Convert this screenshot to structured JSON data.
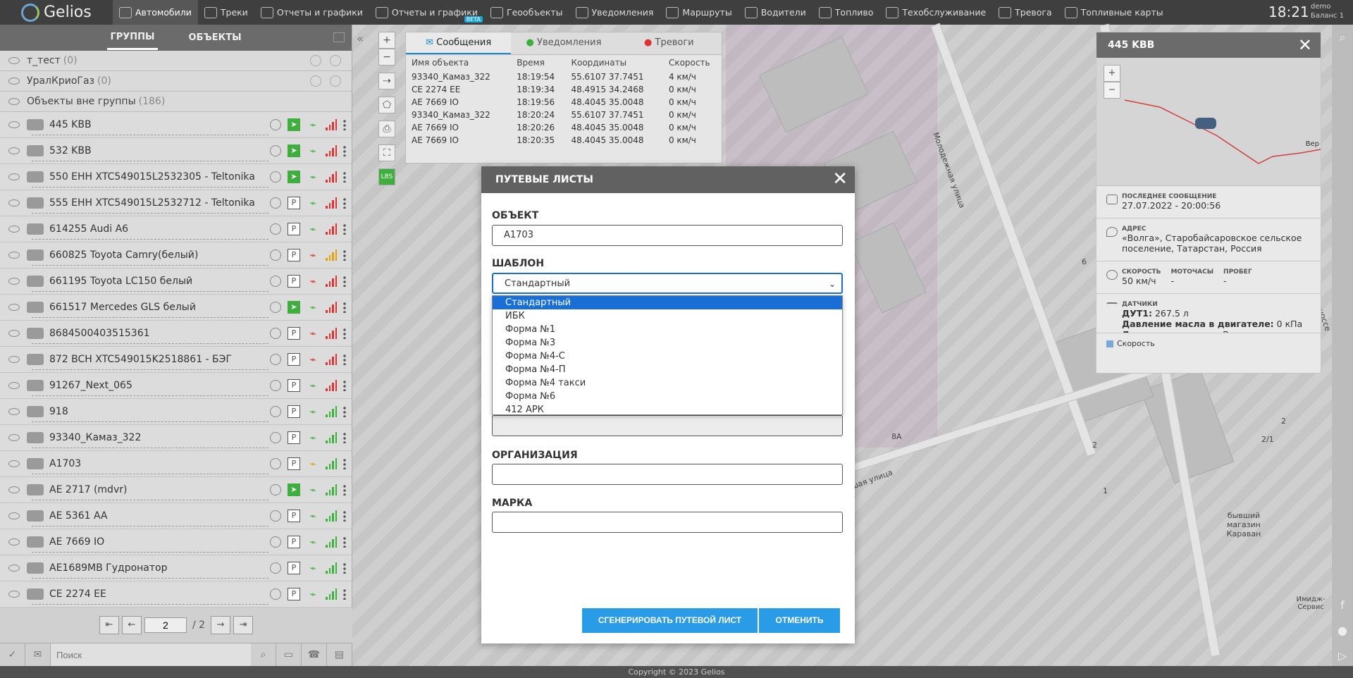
{
  "app": {
    "brand": "Gelios",
    "clock": "18:21",
    "user": "demo",
    "balance": "Баланс 1",
    "copyright": "Copyright © 2023 Gelios"
  },
  "nav": [
    {
      "label": "Автомобили",
      "active": true
    },
    {
      "label": "Треки"
    },
    {
      "label": "Отчеты и графики"
    },
    {
      "label": "Отчеты и графики",
      "badge": "BETA"
    },
    {
      "label": "Геообъекты"
    },
    {
      "label": "Уведомления"
    },
    {
      "label": "Маршруты"
    },
    {
      "label": "Водители"
    },
    {
      "label": "Топливо"
    },
    {
      "label": "Техобслуживание"
    },
    {
      "label": "Тревога"
    },
    {
      "label": "Топливные карты"
    }
  ],
  "left": {
    "tabs": [
      "ГРУППЫ",
      "ОБЪЕКТЫ"
    ],
    "groups": [
      {
        "name": "т_тест",
        "count": "(0)"
      },
      {
        "name": "УралКриоГаз",
        "count": "(0)"
      },
      {
        "name": "Объекты вне группы",
        "count": "(186)"
      }
    ],
    "objects": [
      {
        "name": "445 KBB",
        "status": "move",
        "gps": "ok",
        "sig": "r"
      },
      {
        "name": "532 KBB",
        "status": "move",
        "gps": "ok",
        "sig": "r"
      },
      {
        "name": "550 EHH XTC549015L2532305 - Teltonika",
        "status": "move",
        "gps": "ok",
        "sig": "r"
      },
      {
        "name": "555 EHH XTC549015L2532712 - Teltonika",
        "status": "P",
        "gps": "ok",
        "sig": "r"
      },
      {
        "name": "614255 Audi A6",
        "status": "P",
        "gps": "ok",
        "sig": "r"
      },
      {
        "name": "660825 Toyota Camry(белый)",
        "status": "P",
        "gps": "bad",
        "sig": "y"
      },
      {
        "name": "661195 Toyota LC150 белый",
        "status": "P",
        "gps": "bad",
        "sig": "r"
      },
      {
        "name": "661517 Mercedes GLS белый",
        "status": "move",
        "gps": "ok",
        "sig": "r"
      },
      {
        "name": "8684500403515361",
        "status": "P",
        "gps": "bad",
        "sig": "r"
      },
      {
        "name": "872 BCH XTC549015K2518861 - БЭГ",
        "status": "P",
        "gps": "bad",
        "sig": "r"
      },
      {
        "name": "91267_Next_065",
        "status": "P",
        "gps": "ok",
        "sig": "r"
      },
      {
        "name": "918",
        "status": "P",
        "gps": "ok",
        "sig": "g"
      },
      {
        "name": "93340_Камаз_322",
        "status": "P",
        "gps": "ok",
        "sig": "g"
      },
      {
        "name": "A1703",
        "status": "P",
        "gps": "warn",
        "sig": "g"
      },
      {
        "name": "AE 2717 (mdvr)",
        "status": "move",
        "gps": "ok",
        "sig": "g"
      },
      {
        "name": "AE 5361 AA",
        "status": "P",
        "gps": "ok",
        "sig": "g"
      },
      {
        "name": "AE 7669 IO",
        "status": "P",
        "gps": "ok",
        "sig": "g"
      },
      {
        "name": "AE1689MB Гудронатор",
        "status": "P",
        "gps": "ok",
        "sig": "g"
      },
      {
        "name": "CE 2274 EE",
        "status": "P",
        "gps": "ok",
        "sig": "g"
      }
    ],
    "pager": {
      "page": "2",
      "of": "/ 2"
    },
    "search_placeholder": "Поиск"
  },
  "messages": {
    "tabs": [
      "Сообщения",
      "Уведомления",
      "Тревоги"
    ],
    "columns": [
      "Имя объекта",
      "Время",
      "Координаты",
      "Скорость"
    ],
    "rows": [
      [
        "93340_Камаз_322",
        "18:19:54",
        "55.6107 37.7451",
        "4 км/ч"
      ],
      [
        "CE 2274 EE",
        "18:19:34",
        "48.4915 34.2468",
        "0 км/ч"
      ],
      [
        "AE 7669 IO",
        "18:19:56",
        "48.4045 35.0048",
        "0 км/ч"
      ],
      [
        "93340_Камаз_322",
        "18:20:24",
        "55.6107 37.7451",
        "0 км/ч"
      ],
      [
        "AE 7669 IO",
        "18:20:26",
        "48.4045 35.0048",
        "0 км/ч"
      ],
      [
        "AE 7669 IO",
        "18:20:35",
        "48.4045 35.0048",
        "0 км/ч"
      ]
    ]
  },
  "info": {
    "title": "445 KBB",
    "last_msg_label": "ПОСЛЕДНЕЕ СООБЩЕНИЕ",
    "last_msg": "27.07.2022 - 20:00:56",
    "address_label": "АДРЕС",
    "address": "«Волга», Старобайсаровское сельское поселение, Татарстан, Россия",
    "speed_label": "СКОРОСТЬ",
    "speed": "50 км/ч",
    "moto_label": "МОТОЧАСЫ",
    "moto": "-",
    "mileage_label": "ПРОБЕГ",
    "mileage": "-",
    "sensors_label": "ДАТЧИКИ",
    "sensors": [
      {
        "k": "ДУТ1:",
        "v": "267.5 л"
      },
      {
        "k": "Давление масла в двигателе:",
        "v": "0 кПа"
      },
      {
        "k": "Датчик зажигания:",
        "v": "Включено"
      }
    ],
    "legend": "Скорость",
    "minimap_label": "Вер"
  },
  "map_labels": {
    "street1": "Молодежная улица",
    "street2": "ьшая улица",
    "hwy": "кое шоссе",
    "shop": "бывший магазин Караван",
    "poi": "Имидж-Сервис",
    "n1": "6",
    "n2": "2",
    "n3": "1",
    "n4": "8А",
    "n5": "2/1",
    "n6": "2"
  },
  "modal": {
    "title": "ПУТЕВЫЕ ЛИСТЫ",
    "object_label": "ОБЪЕКТ",
    "object_value": "A1703",
    "template_label": "ШАБЛОН",
    "template_value": "Стандартный",
    "template_options": [
      "Стандартный",
      "ИБК",
      "Форма №1",
      "Форма №3",
      "Форма №4-С",
      "Форма №4-П",
      "Форма №4 такси",
      "Форма №6",
      "412 АРК"
    ],
    "org_label": "ОРГАНИЗАЦИЯ",
    "brand_label": "МАРКА",
    "generate": "СГЕНЕРИРОВАТЬ ПУТЕВОЙ ЛИСТ",
    "cancel": "ОТМЕНИТЬ"
  }
}
